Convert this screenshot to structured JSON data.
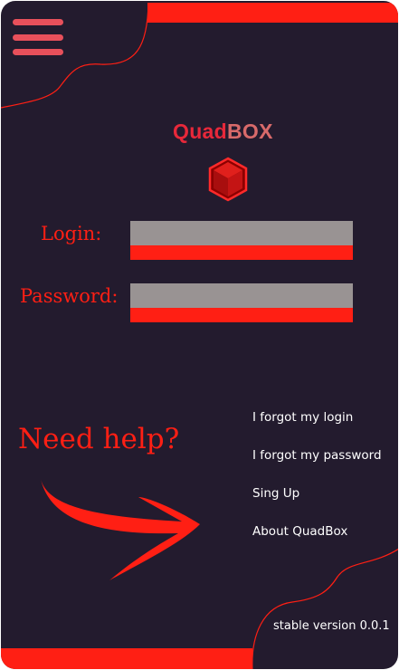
{
  "app": {
    "logo_part1": "Quad",
    "logo_part2": "BOX"
  },
  "login_form": {
    "login_label": "Login:",
    "login_value": "",
    "password_label": "Password:",
    "password_value": ""
  },
  "help": {
    "title": "Need help?",
    "links": [
      "I forgot my login",
      "I forgot my password",
      "Sing Up",
      "About QuadBox"
    ]
  },
  "footer": {
    "version": "stable version 0.0.1"
  },
  "colors": {
    "background": "#231b2e",
    "accent": "#ff1f14",
    "input_fill": "#999393",
    "menu_icon": "#e8505b"
  },
  "icons": [
    "hamburger-menu-icon",
    "cube-logo-icon",
    "curved-arrow-icon"
  ]
}
